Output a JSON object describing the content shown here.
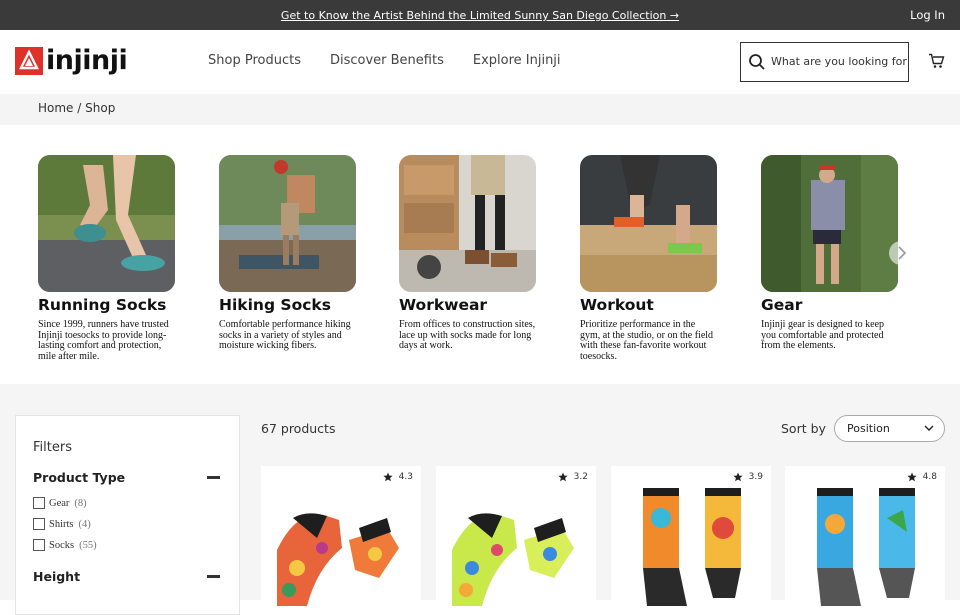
{
  "topbar": {
    "promo": "Get to Know the Artist Behind the Limited Sunny San Diego Collection →",
    "login": "Log In"
  },
  "header": {
    "logo_text": "injinji",
    "nav": [
      "Shop Products",
      "Discover Benefits",
      "Explore Injinji"
    ],
    "search_placeholder": "What are you looking for?",
    "icons": {
      "search": "search-icon",
      "cart": "cart-icon"
    }
  },
  "breadcrumb": {
    "home": "Home",
    "separator": "/",
    "current": "Shop"
  },
  "categories": [
    {
      "title": "Running Socks",
      "desc": "Since 1999, runners have trusted Injinji toesocks to provide long-lasting comfort and protection, mile after mile."
    },
    {
      "title": "Hiking Socks",
      "desc": "Comfortable performance hiking socks in a variety of styles and moisture wicking fibers."
    },
    {
      "title": "Workwear",
      "desc": "From offices to construction sites, lace up with socks made for long days at work."
    },
    {
      "title": "Workout",
      "desc": "Prioritize performance in the gym, at the studio, or on the field with these fan-favorite workout toesocks."
    },
    {
      "title": "Gear",
      "desc": "Injinji gear is designed to keep you comfortable and protected from the elements."
    }
  ],
  "filters": {
    "title": "Filters",
    "sections": [
      {
        "title": "Product Type",
        "options": [
          {
            "label": "Gear",
            "count": "(8)"
          },
          {
            "label": "Shirts",
            "count": "(4)"
          },
          {
            "label": "Socks",
            "count": "(55)"
          }
        ]
      },
      {
        "title": "Height"
      }
    ]
  },
  "listing": {
    "count": "67 products",
    "sort_label": "Sort by",
    "sort_value": "Position"
  },
  "products": [
    {
      "rating": "4.3"
    },
    {
      "rating": "3.2"
    },
    {
      "rating": "3.9"
    },
    {
      "rating": "4.8"
    }
  ],
  "colors": {
    "brand_red": "#e0302a",
    "topbar": "#3a3a3a",
    "panel_bg": "#f5f5f5"
  }
}
